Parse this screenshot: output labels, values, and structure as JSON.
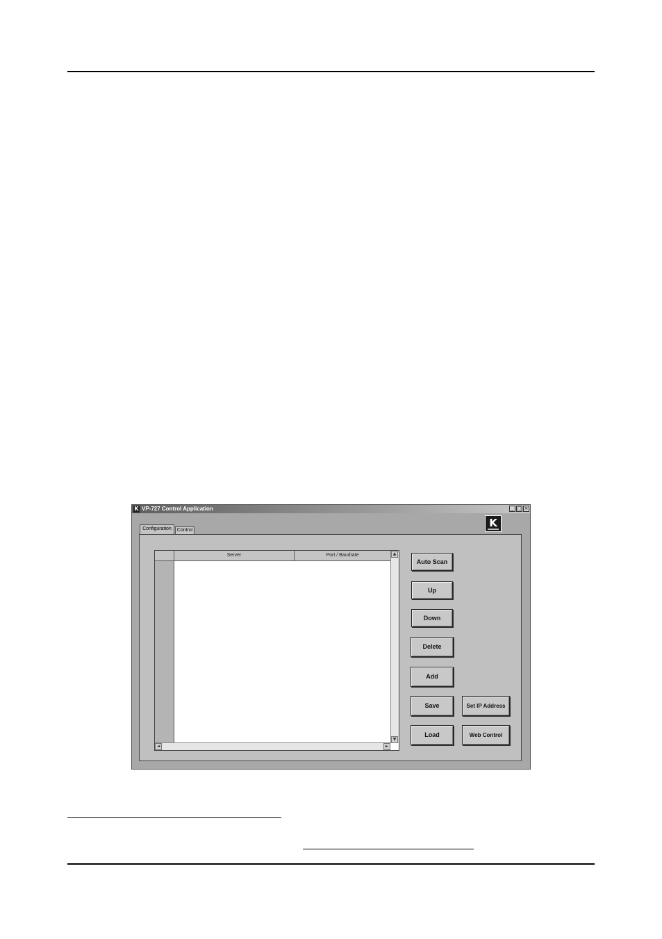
{
  "window": {
    "title": "VP-727 Control Application",
    "logo_letter": "K",
    "controls": {
      "minimize": "_",
      "maximize": "□",
      "close": "×"
    }
  },
  "tabs": [
    {
      "label": "Configuration",
      "active": true
    },
    {
      "label": "Control",
      "active": false
    }
  ],
  "server_list": {
    "columns": [
      "",
      "Server",
      "Port / Baudrate"
    ],
    "rows": []
  },
  "buttons": {
    "auto_scan": "Auto Scan",
    "up": "Up",
    "down": "Down",
    "delete": "Delete",
    "add": "Add",
    "save": "Save",
    "load": "Load",
    "set_ip_address": "Set IP Address",
    "web_control": "Web Control"
  },
  "brand": {
    "logo_icon": "kramer-logo-icon",
    "letter": "K"
  },
  "icons": {
    "scroll_up": "▲",
    "scroll_down": "▼",
    "scroll_left": "◄",
    "scroll_right": "►"
  }
}
